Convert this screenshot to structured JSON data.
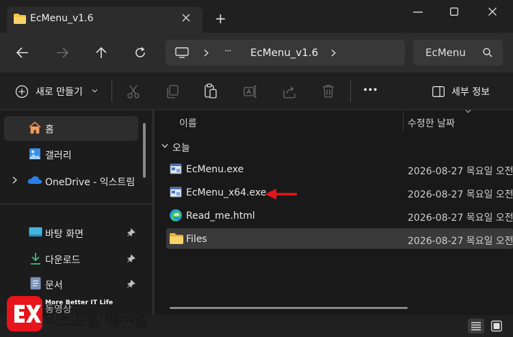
{
  "window": {
    "tab_title": "EcMenu_v1.6",
    "new_tab": "+"
  },
  "address": {
    "more": "···",
    "folder": "EcMenu_v1.6"
  },
  "search": {
    "label": "EcMenu"
  },
  "toolbar": {
    "new_label": "새로 만들기",
    "more": "•••",
    "details_label": "세부 정보"
  },
  "sidebar": {
    "items": [
      {
        "label": "홈"
      },
      {
        "label": "갤러리"
      },
      {
        "label": "OneDrive - 익스트림"
      },
      {
        "label": "바탕 화면"
      },
      {
        "label": "다운로드"
      },
      {
        "label": "문서"
      },
      {
        "label": "동영상"
      }
    ]
  },
  "list": {
    "col_name": "이름",
    "col_modified": "수정한 날짜",
    "group": "오늘",
    "rows": [
      {
        "name": "EcMenu.exe",
        "date": "2026-08-27 목요일 오전"
      },
      {
        "name": "EcMenu_x64.exe",
        "date": "2026-08-27 목요일 오전"
      },
      {
        "name": "Read_me.html",
        "date": "2026-08-27 목요일 오전"
      },
      {
        "name": "Files",
        "date": "2026-08-27 목요일 오전"
      }
    ]
  },
  "watermark": {
    "tagline": "More Better IT Life",
    "name": "익스트림 매뉴얼"
  },
  "colors": {
    "folder": "#f4c542",
    "accent_red": "#e8141b",
    "selected_row": "#3a3a3a"
  }
}
